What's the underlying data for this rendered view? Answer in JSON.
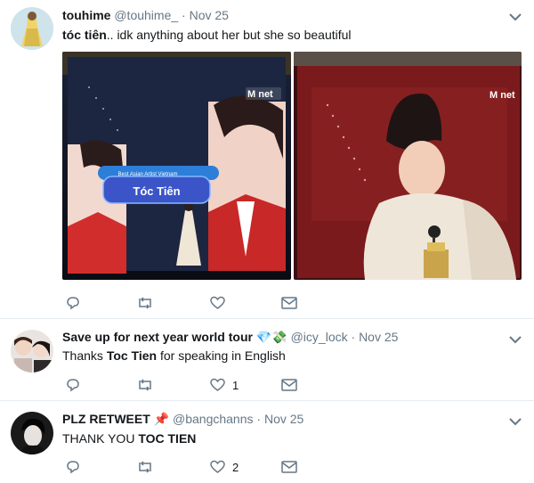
{
  "tweets": [
    {
      "display_name": "touhime",
      "handle": "@touhime_",
      "separator": "·",
      "date": "Nov 25",
      "text_bold": "tóc tiên",
      "text_rest": ".. idk anything about her but she so beautiful",
      "media": {
        "left_overlay_brand": "M net",
        "left_award_label": "Best Asian Artist Vietnam",
        "left_name_banner": "Tóc Tiên",
        "right_overlay_brand": "M net"
      },
      "actions": {
        "reply_icon": "reply-icon",
        "retweet_icon": "retweet-icon",
        "like_icon": "heart-icon",
        "dm_icon": "envelope-icon"
      }
    },
    {
      "display_name": "Save up for next year world tour",
      "name_emoji": "💎💸",
      "handle": "@icy_lock",
      "separator": "·",
      "date": "Nov 25",
      "text_pre": "Thanks ",
      "text_bold": "Toc Tien",
      "text_post": " for speaking in English",
      "like_count": "1"
    },
    {
      "display_name": "PLZ RETWEET",
      "name_emoji": "📌",
      "handle": "@bangchanns",
      "separator": "·",
      "date": "Nov 25",
      "text_pre": "THANK YOU ",
      "text_bold": "TOC TIEN",
      "like_count": "2"
    }
  ],
  "colors": {
    "muted": "#657786",
    "text": "#14171a",
    "border": "#e6ecf0",
    "accent_pink": "#e0245e"
  }
}
